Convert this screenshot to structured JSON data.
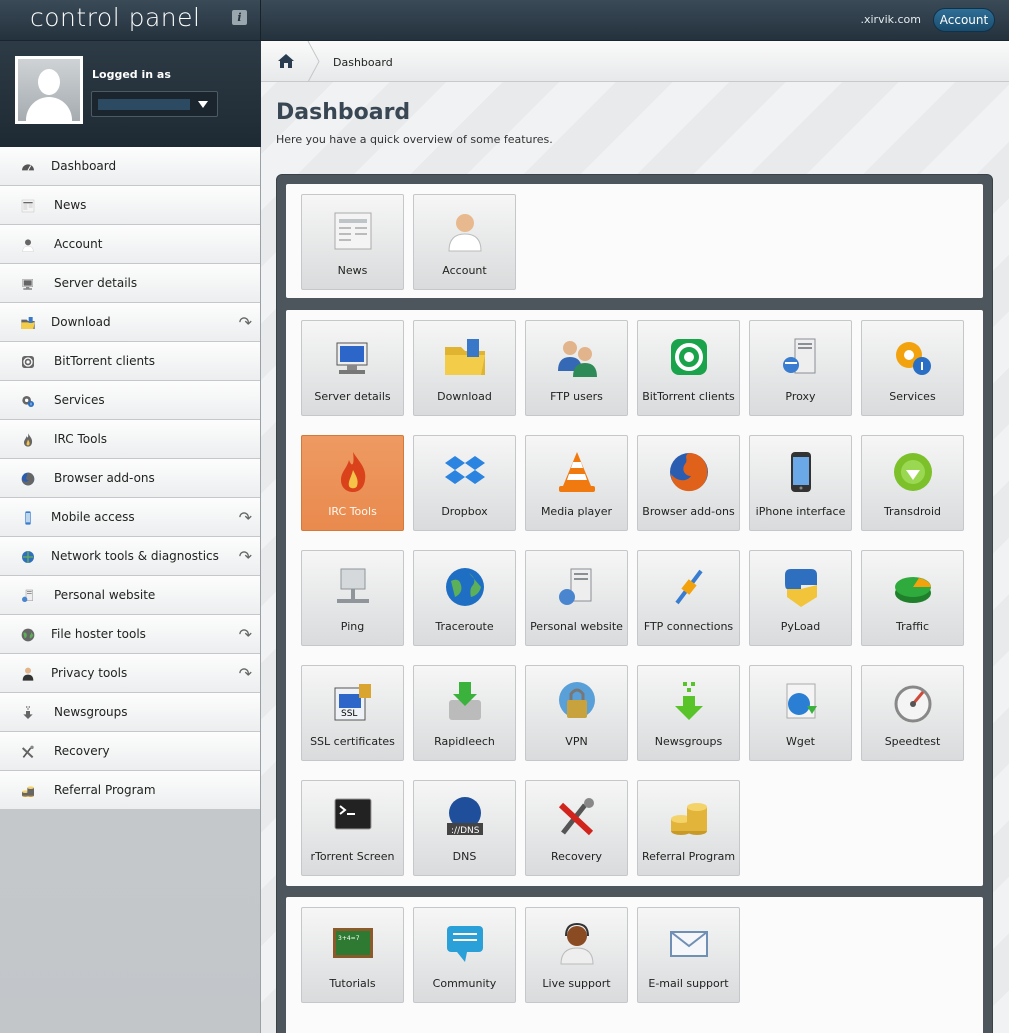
{
  "topbar": {
    "logo": "control panel",
    "domain": ".xirvik.com",
    "account_label": "Account"
  },
  "user": {
    "logged_in_label": "Logged in as"
  },
  "breadcrumb": {
    "current": "Dashboard"
  },
  "page": {
    "title": "Dashboard",
    "subtitle": "Here you have a quick overview of some features."
  },
  "sidebar": {
    "items": [
      {
        "label": "Dashboard",
        "icon": "dashboard-icon",
        "has_arrow": false
      },
      {
        "label": "News",
        "icon": "news-icon",
        "has_arrow": false
      },
      {
        "label": "Account",
        "icon": "account-icon",
        "has_arrow": false
      },
      {
        "label": "Server details",
        "icon": "server-icon",
        "has_arrow": false
      },
      {
        "label": "Download",
        "icon": "download-icon",
        "has_arrow": true
      },
      {
        "label": "BitTorrent clients",
        "icon": "bittorrent-icon",
        "has_arrow": false
      },
      {
        "label": "Services",
        "icon": "services-icon",
        "has_arrow": false
      },
      {
        "label": "IRC Tools",
        "icon": "irc-icon",
        "has_arrow": false
      },
      {
        "label": "Browser add-ons",
        "icon": "firefox-icon",
        "has_arrow": false
      },
      {
        "label": "Mobile access",
        "icon": "mobile-icon",
        "has_arrow": true
      },
      {
        "label": "Network tools & diagnostics",
        "icon": "network-icon",
        "has_arrow": true
      },
      {
        "label": "Personal website",
        "icon": "website-icon",
        "has_arrow": false
      },
      {
        "label": "File hoster tools",
        "icon": "globe-icon",
        "has_arrow": true
      },
      {
        "label": "Privacy tools",
        "icon": "privacy-icon",
        "has_arrow": true
      },
      {
        "label": "Newsgroups",
        "icon": "newsgroups-icon",
        "has_arrow": false
      },
      {
        "label": "Recovery",
        "icon": "recovery-icon",
        "has_arrow": false
      },
      {
        "label": "Referral Program",
        "icon": "coins-icon",
        "has_arrow": false
      }
    ]
  },
  "panels": [
    {
      "tiles": [
        {
          "label": "News",
          "icon": "news-icon",
          "color": "#bfc4c8"
        },
        {
          "label": "Account",
          "icon": "account-icon",
          "color": "#e8b98e"
        }
      ]
    },
    {
      "tiles": [
        {
          "label": "Server details",
          "icon": "server-icon",
          "color": "#2c66c9"
        },
        {
          "label": "Download",
          "icon": "download-icon",
          "color": "#e0b430"
        },
        {
          "label": "FTP users",
          "icon": "users-icon",
          "color": "#2e8b57"
        },
        {
          "label": "BitTorrent clients",
          "icon": "bittorrent-icon",
          "color": "#1aa34a"
        },
        {
          "label": "Proxy",
          "icon": "proxy-icon",
          "color": "#8a8f94"
        },
        {
          "label": "Services",
          "icon": "services-icon",
          "color": "#f2a20c"
        },
        {
          "label": "IRC Tools",
          "icon": "irc-icon",
          "color": "#d9421a",
          "active": true
        },
        {
          "label": "Dropbox",
          "icon": "dropbox-icon",
          "color": "#2a84e0"
        },
        {
          "label": "Media player",
          "icon": "vlc-icon",
          "color": "#f07a10"
        },
        {
          "label": "Browser add-ons",
          "icon": "firefox-icon",
          "color": "#e0621a"
        },
        {
          "label": "iPhone interface",
          "icon": "iphone-icon",
          "color": "#333333"
        },
        {
          "label": "Transdroid",
          "icon": "transdroid-icon",
          "color": "#7cc02a"
        },
        {
          "label": "Ping",
          "icon": "ping-icon",
          "color": "#8f959a"
        },
        {
          "label": "Traceroute",
          "icon": "globe-icon",
          "color": "#1e6fc4"
        },
        {
          "label": "Personal website",
          "icon": "website-icon",
          "color": "#8a8f94"
        },
        {
          "label": "FTP connections",
          "icon": "connection-icon",
          "color": "#f2a20c"
        },
        {
          "label": "PyLoad",
          "icon": "pyload-icon",
          "color": "#2f6fbf"
        },
        {
          "label": "Traffic",
          "icon": "traffic-icon",
          "color": "#2faa3c"
        },
        {
          "label": "SSL certificates",
          "icon": "ssl-icon",
          "color": "#2c66c9"
        },
        {
          "label": "Rapidleech",
          "icon": "rapidleech-icon",
          "color": "#3bb23b"
        },
        {
          "label": "VPN",
          "icon": "vpn-icon",
          "color": "#c8a23c"
        },
        {
          "label": "Newsgroups",
          "icon": "newsgroups-icon",
          "color": "#58c42a"
        },
        {
          "label": "Wget",
          "icon": "wget-icon",
          "color": "#2a7fd4"
        },
        {
          "label": "Speedtest",
          "icon": "speedtest-icon",
          "color": "#d04a3a"
        },
        {
          "label": "rTorrent Screen",
          "icon": "terminal-icon",
          "color": "#222222"
        },
        {
          "label": "DNS",
          "icon": "dns-icon",
          "color": "#1f4f9a"
        },
        {
          "label": "Recovery",
          "icon": "recovery-icon",
          "color": "#d0241c"
        },
        {
          "label": "Referral Program",
          "icon": "coins-icon",
          "color": "#e2b43a"
        }
      ]
    },
    {
      "tiles": [
        {
          "label": "Tutorials",
          "icon": "chalkboard-icon",
          "color": "#2f7a32"
        },
        {
          "label": "Community",
          "icon": "chat-icon",
          "color": "#2aa0d8"
        },
        {
          "label": "Live support",
          "icon": "support-icon",
          "color": "#8a4a22"
        },
        {
          "label": "E-mail support",
          "icon": "email-icon",
          "color": "#6f8fb5"
        }
      ]
    }
  ]
}
